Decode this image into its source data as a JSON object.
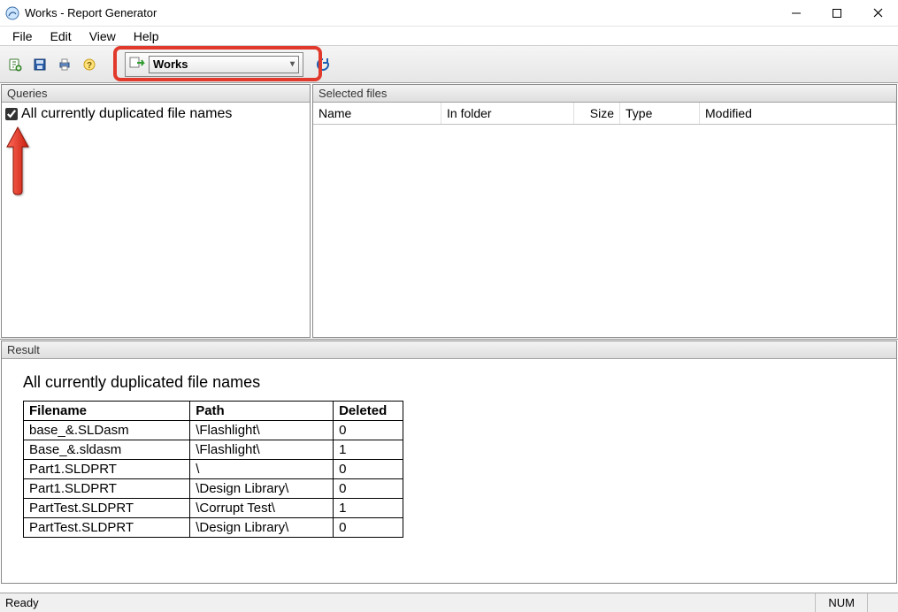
{
  "window": {
    "title": "Works - Report Generator"
  },
  "menu": {
    "file": "File",
    "edit": "Edit",
    "view": "View",
    "help": "Help"
  },
  "toolbar": {
    "vault_selected": "Works"
  },
  "panels": {
    "queries_title": "Queries",
    "selected_files_title": "Selected files",
    "result_title": "Result"
  },
  "queries": {
    "items": [
      {
        "checked": true,
        "label": "All currently duplicated file names"
      }
    ]
  },
  "files_columns": {
    "name": "Name",
    "folder": "In folder",
    "size": "Size",
    "type": "Type",
    "modified": "Modified"
  },
  "result": {
    "heading": "All currently duplicated file names",
    "columns": {
      "filename": "Filename",
      "path": "Path",
      "deleted": "Deleted"
    },
    "rows": [
      {
        "filename": "base_&.SLDasm",
        "path": "\\Flashlight\\",
        "deleted": "0"
      },
      {
        "filename": "Base_&.sldasm",
        "path": "\\Flashlight\\",
        "deleted": "1"
      },
      {
        "filename": "Part1.SLDPRT",
        "path": "\\",
        "deleted": "0"
      },
      {
        "filename": "Part1.SLDPRT",
        "path": "\\Design Library\\",
        "deleted": "0"
      },
      {
        "filename": "PartTest.SLDPRT",
        "path": "\\Corrupt Test\\",
        "deleted": "1"
      },
      {
        "filename": "PartTest.SLDPRT",
        "path": "\\Design Library\\",
        "deleted": "0"
      }
    ]
  },
  "statusbar": {
    "ready": "Ready",
    "num": "NUM"
  }
}
